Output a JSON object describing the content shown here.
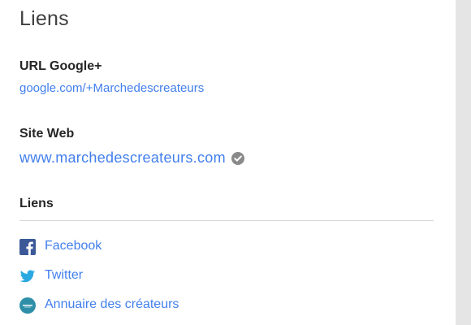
{
  "section": {
    "title": "Liens"
  },
  "google_plus": {
    "label": "URL Google+",
    "url": "google.com/+Marchedescreateurs"
  },
  "website": {
    "label": "Site Web",
    "url": "www.marchedescreateurs.com",
    "verified_icon": "check-circle-icon"
  },
  "links": {
    "label": "Liens",
    "items": [
      {
        "label": "Facebook",
        "icon": "facebook-icon"
      },
      {
        "label": "Twitter",
        "icon": "twitter-icon"
      },
      {
        "label": "Annuaire des créateurs",
        "icon": "site-favicon-icon"
      }
    ]
  },
  "colors": {
    "link": "#427fed",
    "facebook": "#3b5998",
    "twitter": "#2aa9e0",
    "verified": "#8a8a8a",
    "favicon": "#2f8fa8"
  }
}
